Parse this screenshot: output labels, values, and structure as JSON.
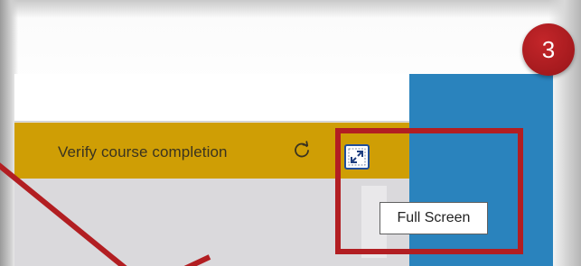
{
  "course_bar": {
    "verify_label": "Verify course completion",
    "refresh_icon": "refresh-icon",
    "fullscreen_icon": "fullscreen-icon"
  },
  "tooltip": {
    "text": "Full Screen"
  },
  "callout": {
    "step_number": "3",
    "highlight_color": "#b21e22",
    "badge_color": "#b21e22"
  },
  "colors": {
    "course_bar": "#cf9e05",
    "side_panel": "#2a83bd",
    "button_border": "#1f4e9c"
  }
}
